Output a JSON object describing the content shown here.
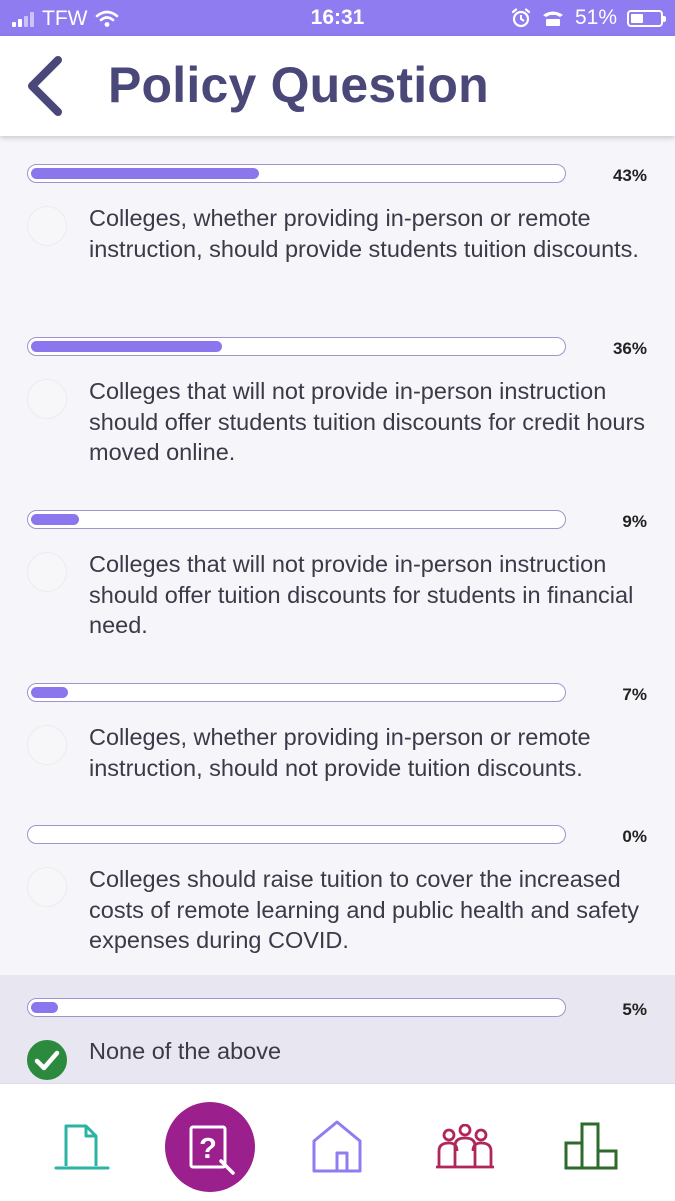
{
  "status_bar": {
    "carrier": "TFW",
    "time": "16:31",
    "battery": "51%"
  },
  "header": {
    "title": "Policy Question",
    "back_icon": "chevron-left-icon"
  },
  "colors": {
    "status_bar": "#8e7cf0",
    "title": "#4a4878",
    "bar_fill": "#8b76ee",
    "bar_border": "#9d95cc",
    "selected_bg": "#e8e6f0",
    "check": "#2b8a3e",
    "nav_docs": "#2bb3a3",
    "nav_question": "#9b1f8c",
    "nav_home": "#8e7cf0",
    "nav_people": "#b0265b",
    "nav_results": "#2b6b2b"
  },
  "options": [
    {
      "percent_label": "43%",
      "value": 0.43,
      "text": "Colleges, whether providing in-person or remote instruction, should provide students tuition discounts.",
      "selected": false
    },
    {
      "percent_label": "36%",
      "value": 0.36,
      "text": "Colleges that will not provide in-person instruction should offer students tuition discounts for credit hours moved online.",
      "selected": false
    },
    {
      "percent_label": "9%",
      "value": 0.09,
      "text": "Colleges that will not provide in-person instruction should offer tuition discounts for students in financial need.",
      "selected": false
    },
    {
      "percent_label": "7%",
      "value": 0.07,
      "text": "Colleges, whether providing in-person or remote instruction, should not provide tuition discounts.",
      "selected": false
    },
    {
      "percent_label": "0%",
      "value": 0.0,
      "text": "Colleges should raise tuition to cover the increased costs of remote learning and public health and safety expenses during COVID.",
      "selected": false
    },
    {
      "percent_label": "5%",
      "value": 0.05,
      "text": "None of the above",
      "selected": true
    }
  ],
  "bottom_nav": [
    {
      "icon": "document-icon"
    },
    {
      "icon": "question-search-icon"
    },
    {
      "icon": "home-icon"
    },
    {
      "icon": "community-icon"
    },
    {
      "icon": "bar-chart-icon"
    }
  ]
}
